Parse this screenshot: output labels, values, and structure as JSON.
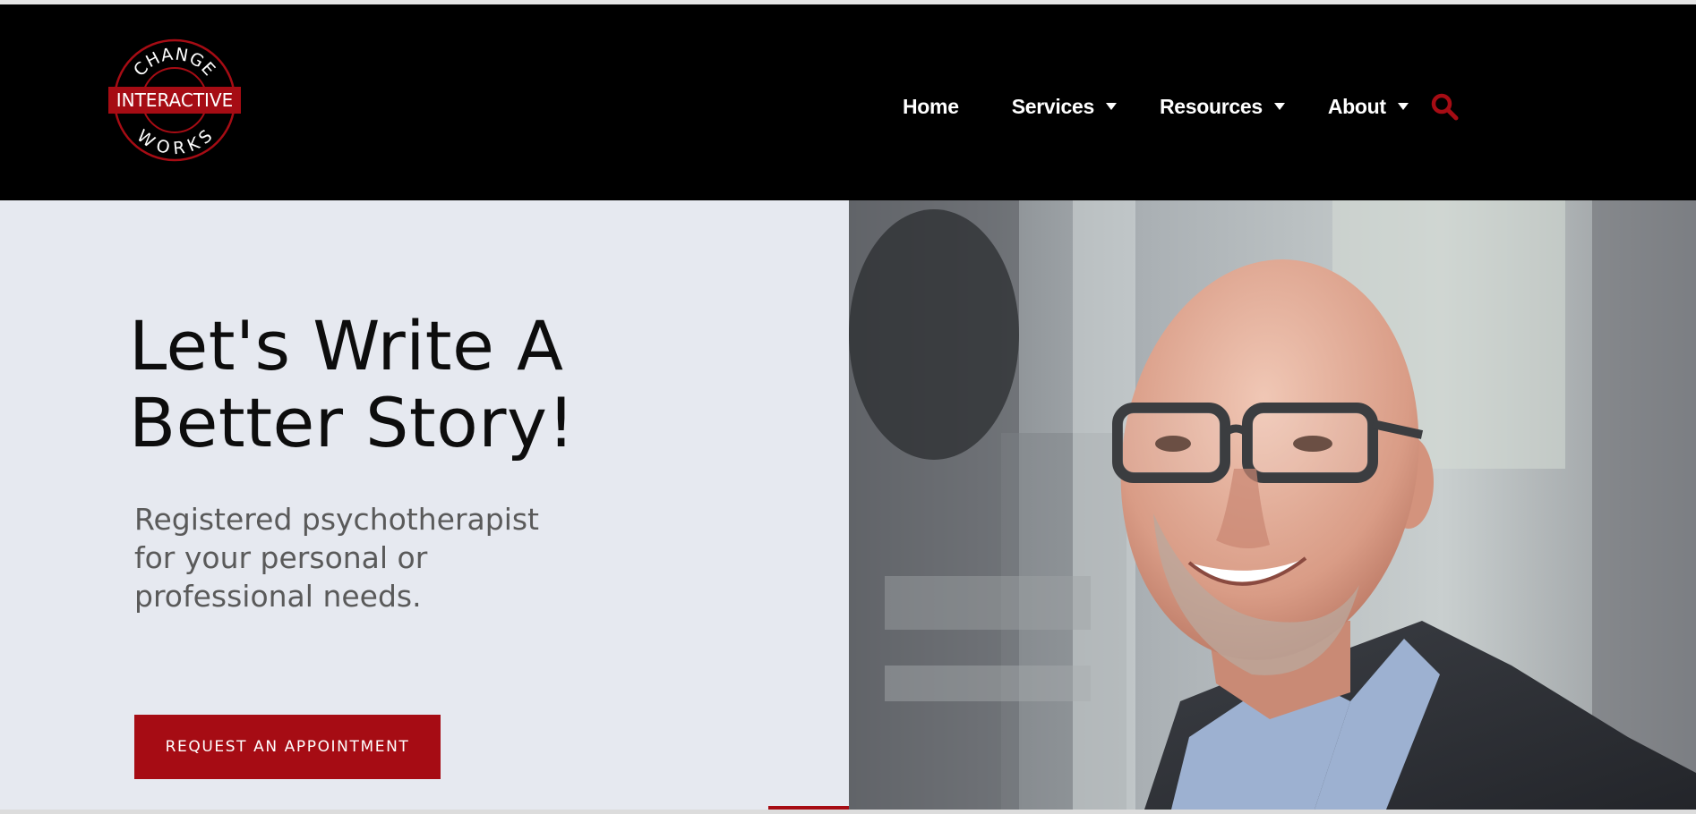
{
  "logo": {
    "top_text": "CHANGE",
    "middle_text": "INTERACTIVE",
    "bottom_text": "WORKS",
    "icon": "change-interactive-works-logo"
  },
  "nav": {
    "items": [
      {
        "label": "Home",
        "has_dropdown": false
      },
      {
        "label": "Services",
        "has_dropdown": true
      },
      {
        "label": "Resources",
        "has_dropdown": true
      },
      {
        "label": "About",
        "has_dropdown": true
      }
    ],
    "search_icon": "search-icon"
  },
  "hero": {
    "title_line1": "Let's Write A",
    "title_line2": "Better Story!",
    "subtitle": "Registered psychotherapist for your personal or professional needs.",
    "cta_label": "REQUEST AN APPOINTMENT",
    "photo": "portrait-photo"
  },
  "colors": {
    "accent": "#a60c14",
    "header_bg": "#000000",
    "hero_bg": "#e6e9f0",
    "title_text": "#0d0d0d",
    "subtitle_text": "#5a5a5a"
  }
}
